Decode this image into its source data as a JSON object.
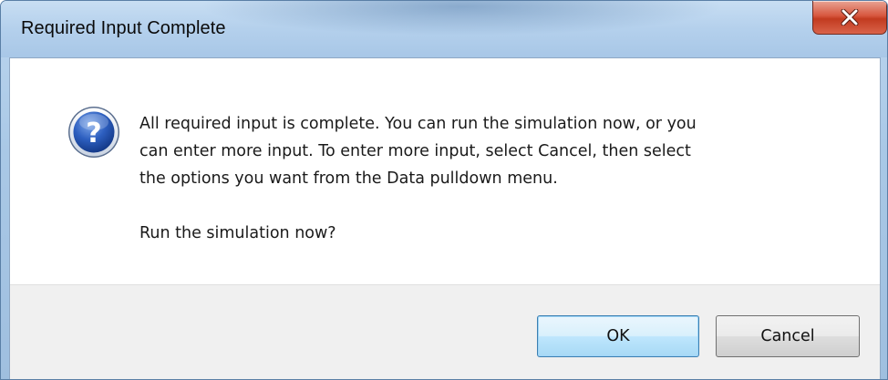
{
  "window": {
    "title": "Required Input Complete",
    "close_icon": "close-icon",
    "close_button_color": "#c23b20"
  },
  "dialog": {
    "icon": "question-icon",
    "icon_color": "#1f4fa8",
    "message_lines": [
      "All required input is complete. You can run the simulation now, or you",
      "can enter more input. To enter more input, select Cancel, then select",
      "the options you want from the Data pulldown menu."
    ],
    "question": "Run the simulation now?"
  },
  "buttons": {
    "ok_label": "OK",
    "cancel_label": "Cancel"
  }
}
